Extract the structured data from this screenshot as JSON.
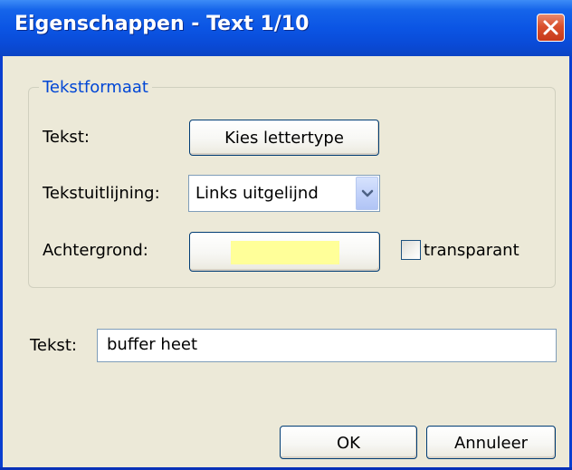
{
  "window": {
    "title": "Eigenschappen - Text 1/10"
  },
  "group": {
    "label": "Tekstformaat"
  },
  "text_format": {
    "font_label": "Tekst:",
    "font_button": "Kies lettertype",
    "align_label": "Tekstuitlijning:",
    "align_value": "Links uitgelijnd",
    "background_label": "Achtergrond:",
    "background_color": "#ffff99",
    "transparent_label": "transparant",
    "transparent_checked": false
  },
  "text_field": {
    "label": "Tekst:",
    "value": "buffer heet"
  },
  "buttons": {
    "ok": "OK",
    "cancel": "Annuleer"
  },
  "colors": {
    "titlebar": "#0a4ad6",
    "dialog_bg": "#ece9d8",
    "group_label": "#0046d5",
    "close_button": "#d9502c"
  }
}
